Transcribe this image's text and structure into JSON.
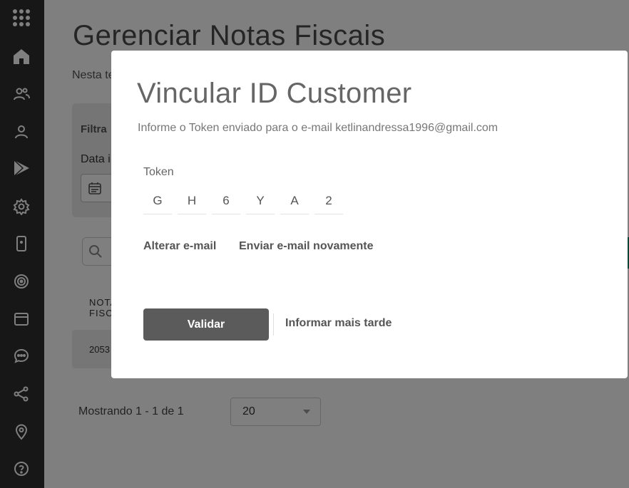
{
  "sidebar": {
    "items": [
      {
        "icon": "apps-grid-icon"
      },
      {
        "icon": "home-icon"
      },
      {
        "icon": "users-icon"
      },
      {
        "icon": "user-icon"
      },
      {
        "icon": "play-store-icon"
      },
      {
        "icon": "settings-icon"
      },
      {
        "icon": "mobile-device-icon"
      },
      {
        "icon": "target-icon"
      },
      {
        "icon": "browser-window-icon"
      },
      {
        "icon": "chat-icon"
      },
      {
        "icon": "share-icon"
      },
      {
        "icon": "location-pin-icon"
      },
      {
        "icon": "help-icon"
      }
    ]
  },
  "page": {
    "title": "Gerenciar Notas Fiscais",
    "subtitle": "Nesta te",
    "filter": {
      "title": "Filtra",
      "date_label": "Data i"
    },
    "table": {
      "col_header": "NOTA FISCAL",
      "rows": [
        {
          "value": "2053"
        }
      ]
    },
    "pager": {
      "text": "Mostrando 1 - 1 de 1",
      "page_size": "20"
    }
  },
  "modal": {
    "title": "Vincular ID Customer",
    "subtitle": "Informe o Token enviado para o e-mail ketlinandressa1996@gmail.com",
    "token_label": "Token",
    "token": [
      "G",
      "H",
      "6",
      "Y",
      "A",
      "2"
    ],
    "change_email": "Alterar e-mail",
    "resend_email": "Enviar e-mail novamente",
    "validate": "Validar",
    "later": "Informar mais tarde"
  },
  "colors": {
    "sidebar": "#2f2f2f",
    "overlay": "rgba(0,0,0,0.5)",
    "primary_button": "#5b5b5b",
    "accent": "#0c8a6a"
  }
}
